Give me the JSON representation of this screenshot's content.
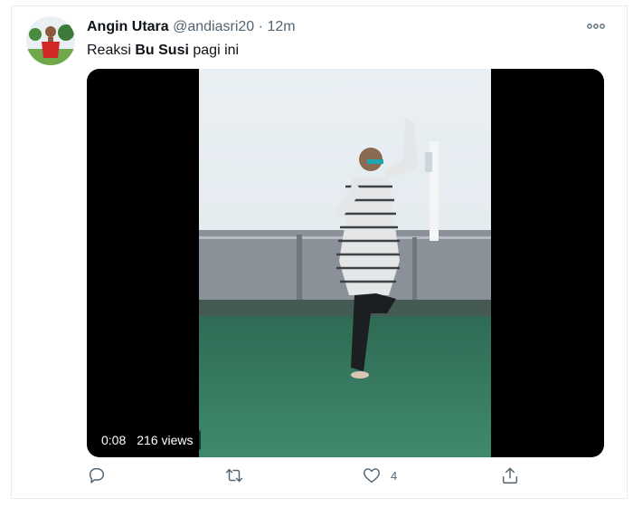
{
  "tweet": {
    "author_name": "Angin Utara",
    "handle": "@andiasri20",
    "separator": "·",
    "time": "12m",
    "text_before": "Reaksi ",
    "text_bold": "Bu Susi",
    "text_after": " pagi ini"
  },
  "video": {
    "duration": "0:08",
    "views": "216 views"
  },
  "actions": {
    "reply_icon": "reply-icon",
    "retweet_icon": "retweet-icon",
    "like_icon": "heart-icon",
    "like_count": "4",
    "share_icon": "share-icon"
  },
  "colors": {
    "text_primary": "#0f1419",
    "text_secondary": "#536471",
    "border": "#e6ecf0"
  }
}
